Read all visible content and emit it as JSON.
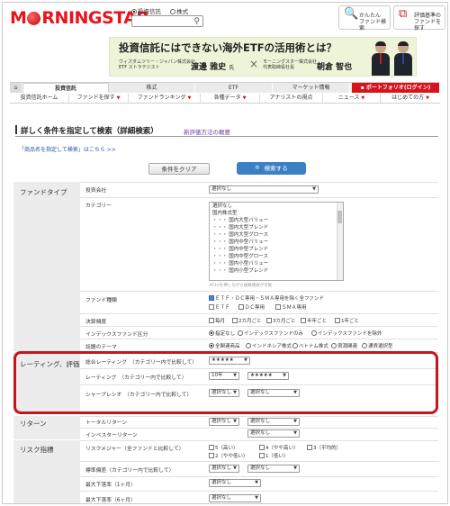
{
  "header": {
    "logo": "MORNINGSTAR",
    "radio_fund": "投資信託",
    "radio_stock": "株式",
    "btn_easy_line1": "かんたん",
    "btn_easy_line2": "ファンド検索",
    "btn_rated_line1": "評価基準の",
    "btn_rated_line2": "ファンドを探す"
  },
  "banner": {
    "title": "投資信託にはできない海外ETFの活用術とは？",
    "left_org1": "ウィズダムツリー・ジャパン株式会社",
    "left_org2": "ETF ストラテジスト",
    "left_name": "渡邊 雅史",
    "left_suffix": "氏",
    "times": "×",
    "right_org1": "モーニングスター株式会社",
    "right_org2": "代表取締役社長",
    "right_name": "朝倉 智也"
  },
  "nav_main": [
    "投資信託",
    "株式",
    "ETF",
    "マーケット情報"
  ],
  "nav_portfolio": "ポートフォリオ(ログイン)",
  "nav_sub": [
    "投資信託ホーム",
    "ファンドを探す",
    "ファンドランキング",
    "各種データ",
    "アナリストの視点",
    "ニュース",
    "はじめての方"
  ],
  "page": {
    "title": "詳しく条件を指定して検索（詳細検索）",
    "overview_link": "新評価方法の概要",
    "name_search_note": "「商品名を指定して検索」はこちら >>",
    "clear_button": "条件をクリア",
    "search_button": "検索する"
  },
  "form": {
    "fund_type": {
      "label": "ファンドタイプ",
      "company_label": "投資会社",
      "company_value": "選択なし",
      "category_label": "カテゴリー",
      "category_options": [
        "選択なし",
        "国内株式型",
        "・・・ 国内大型バリュー",
        "・・・ 国内大型ブレンド",
        "・・・ 国内大型グロース",
        "・・・ 国内中型バリュー",
        "・・・ 国内中型ブレンド",
        "・・・ 国内中型グロース",
        "・・・ 国内小型バリュー",
        "・・・ 国内小型ブレンド"
      ],
      "category_note": "※Ctrlを押しながら複数選択が可能",
      "fund_kind_label": "ファンド種類",
      "fund_kind_opt1": "ＥＴＦ・ＤＣ専用・ＳＭＡ専用を除く全ファンド",
      "fund_kind_opt2": "ＥＴＦ",
      "fund_kind_opt3": "ＤＣ専用",
      "fund_kind_opt4": "ＳＭＡ専用",
      "settle_label": "決算頻度",
      "settle_opts": [
        "毎月",
        "2カ月ごと",
        "3カ月ごと",
        "半年ごと",
        "1年ごと"
      ],
      "index_label": "インデックスファンド区分",
      "index_opts": [
        "指定なし",
        "インデックスファンドのみ",
        "インデックスファンドを除外"
      ],
      "theme_label": "話題のテーマ",
      "theme_opts": [
        "全関連商品",
        "インドネシア株式",
        "ベトナム株式",
        "資源関連",
        "通貨選択型"
      ]
    },
    "rating": {
      "label": "レーティング、評価",
      "overall_label": "総合レーティング　（カテゴリー内で比較して）",
      "overall_value": "★★★★★",
      "rating_label": "レーティング　（カテゴリー内で比較して）",
      "rating_period": "10年",
      "rating_value": "★★★★★",
      "sharpe_label": "シャープレシオ　（カテゴリー内で比較して）",
      "sharpe_value1": "選択なし",
      "sharpe_value2": "選択なし"
    },
    "return": {
      "label": "リターン",
      "total_label": "トータルリターン",
      "total_value1": "選択なし",
      "total_value2": "選択なし",
      "investor_label": "インベスターリターン",
      "investor_value": "選択なし"
    },
    "risk": {
      "label": "リスク指標",
      "measure_label": "リスクメジャー（全ファンドと比較して）",
      "measure_opts": [
        "5（高い）",
        "4（やや高い）",
        "3（平均的）",
        "2（やや低い）",
        "1（低い）"
      ],
      "std_label": "標準偏差（カテゴリー内で比較して）",
      "std_value1": "選択なし",
      "std_value2": "選択なし",
      "dd1_label": "最大下落率（1ヶ月）",
      "dd1_value": "選択なし",
      "dd6_label": "最大下落率（6ヶ月）",
      "dd6_value": "選択なし"
    }
  }
}
